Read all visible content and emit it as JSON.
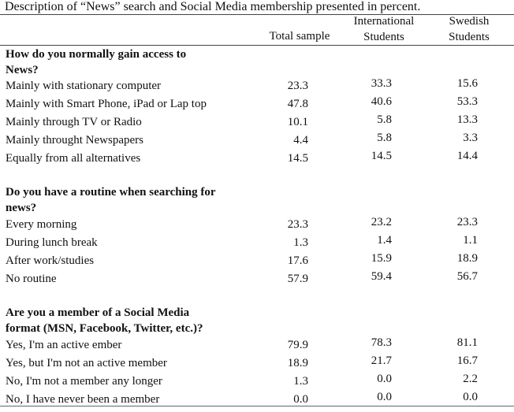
{
  "caption": "Description of “News” search and Social Media membership presented in percent.",
  "columns": {
    "total": "Total sample",
    "international": [
      "International",
      "Students"
    ],
    "swedish": [
      "Swedish",
      "Students"
    ]
  },
  "sections": [
    {
      "title": [
        "How do you normally gain access to",
        "News?"
      ],
      "rows": [
        {
          "label": "Mainly with stationary  computer",
          "total": "23.3",
          "international": "33.3",
          "swedish": "15.6"
        },
        {
          "label": "Mainly with Smart Phone, iPad or Lap top",
          "total": "47.8",
          "international": "40.6",
          "swedish": "53.3"
        },
        {
          "label": "Mainly through TV or Radio",
          "total": "10.1",
          "international": "5.8",
          "swedish": "13.3"
        },
        {
          "label": "Mainly throught Newspapers",
          "total": "4.4",
          "international": "5.8",
          "swedish": "3.3"
        },
        {
          "label": "Equally from all alternatives",
          "total": "14.5",
          "international": "14.5",
          "swedish": "14.4"
        }
      ]
    },
    {
      "title": [
        "Do you have a routine when searching for",
        "news?"
      ],
      "rows": [
        {
          "label": "Every morning",
          "total": "23.3",
          "international": "23.2",
          "swedish": "23.3"
        },
        {
          "label": "During lunch break",
          "total": "1.3",
          "international": "1.4",
          "swedish": "1.1"
        },
        {
          "label": "After work/studies",
          "total": "17.6",
          "international": "15.9",
          "swedish": "18.9"
        },
        {
          "label": "No routine",
          "total": "57.9",
          "international": "59.4",
          "swedish": "56.7"
        }
      ]
    },
    {
      "title": [
        "Are you a member of a Social Media",
        "format (MSN, Facebook, Twitter, etc.)?"
      ],
      "rows": [
        {
          "label": "Yes, I'm an active ember",
          "total": "79.9",
          "international": "78.3",
          "swedish": "81.1"
        },
        {
          "label": "Yes, but I'm not an active member",
          "total": "18.9",
          "international": "21.7",
          "swedish": "16.7"
        },
        {
          "label": "No, I'm not a member any longer",
          "total": "1.3",
          "international": "0.0",
          "swedish": "2.2"
        },
        {
          "label": "No, I have never been a member",
          "total": "0.0",
          "international": "0.0",
          "swedish": "0.0"
        }
      ]
    }
  ]
}
